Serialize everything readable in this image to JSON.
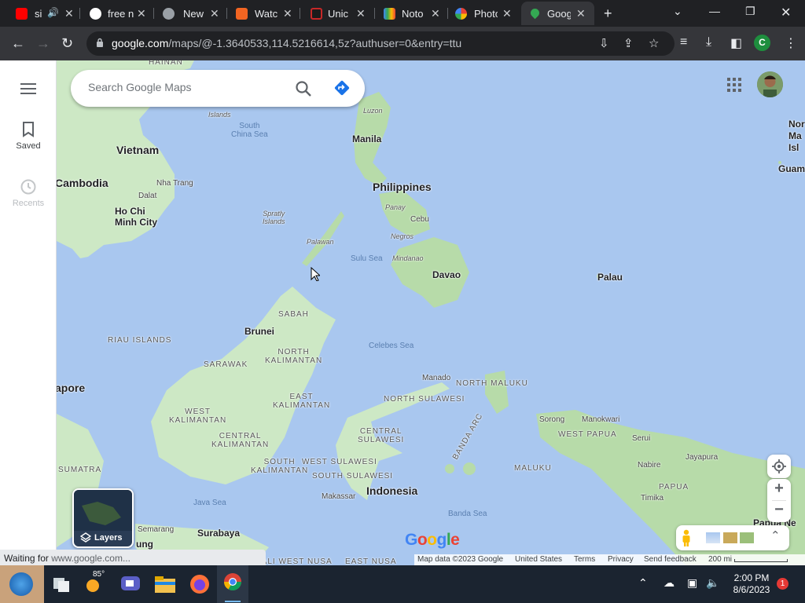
{
  "browser": {
    "tabs": [
      {
        "label": "si",
        "favicon": "youtube-icon",
        "color": "#ff0000"
      },
      {
        "label": "free n",
        "favicon": "google-icon",
        "color": "#4285f4"
      },
      {
        "label": "New",
        "favicon": "chrome-icon",
        "color": "#9aa0a6"
      },
      {
        "label": "Watc",
        "favicon": "tumblr-icon",
        "color": "#f26522"
      },
      {
        "label": "Unic",
        "favicon": "unicode-icon",
        "color": "#c62828"
      },
      {
        "label": "Noto",
        "favicon": "noto-icon",
        "color": "#34a853"
      },
      {
        "label": "Photo",
        "favicon": "photos-icon",
        "color": "#fbbc05"
      },
      {
        "label": "Goog",
        "favicon": "maps-icon",
        "color": "#34a853"
      }
    ],
    "url_domain": "google.com",
    "url_path": "/maps/@-1.3640533,114.5216614,5z?authuser=0&entry=ttu",
    "profile_initial": "C"
  },
  "sidebar": {
    "menu_icon": "hamburger-menu-icon",
    "items": [
      {
        "label": "Saved",
        "icon": "bookmark-icon"
      },
      {
        "label": "Recents",
        "icon": "history-icon"
      }
    ]
  },
  "search": {
    "placeholder": "Search Google Maps"
  },
  "map": {
    "labels": {
      "hainan": "HAINAN",
      "luzon": "Luzon",
      "islands": "Islands",
      "south_china_sea": "South\nChina Sea",
      "manila": "Manila",
      "vietnam": "Vietnam",
      "philippines": "Philippines",
      "cambodia": "Cambodia",
      "dalat": "Dalat",
      "nha_trang": "Nha Trang",
      "panay": "Panay",
      "cebu": "Cebu",
      "ho_chi_minh": "Ho Chi\nMinh City",
      "spratly": "Spratly\nIslands",
      "negros": "Negros",
      "palawan": "Palawan",
      "sulu_sea": "Sulu Sea",
      "mindanao": "Mindanao",
      "davao": "Davao",
      "palau": "Palau",
      "sabah": "SABAH",
      "brunei": "Brunei",
      "riau": "RIAU ISLANDS",
      "north_kalimantan": "NORTH\nKALIMANTAN",
      "sarawak": "SARAWAK",
      "celebes_sea": "Celebes Sea",
      "singapore": "apore",
      "manado": "Manado",
      "north_maluku": "NORTH MALUKU",
      "east_kalimantan": "EAST\nKALIMANTAN",
      "north_sulawesi": "NORTH SULAWESI",
      "west_kalimantan": "WEST\nKALIMANTAN",
      "sorong": "Sorong",
      "manokwari": "Manokwari",
      "central_sulawesi": "CENTRAL\nSULAWESI",
      "west_papua": "WEST PAPUA",
      "central_kalimantan": "CENTRAL\nKALIMANTAN",
      "serui": "Serui",
      "banda_arc": "BANDA ARC",
      "jayapura": "Jayapura",
      "south_kalimantan": "SOUTH\nKALIMANTAN",
      "west_sulawesi": "WEST SULAWESI",
      "nabire": "Nabire",
      "maluku": "MALUKU",
      "sumatra": "SUMATRA",
      "south_sulawesi": "SOUTH SULAWESI",
      "papua": "PAPUA",
      "indonesia": "Indonesia",
      "java_sea": "Java Sea",
      "makassar": "Makassar",
      "timika": "Timika",
      "banda_sea": "Banda Sea",
      "papua_new": "Papua Ne",
      "semarang": "Semarang",
      "surabaya": "Surabaya",
      "jung": "ung",
      "bali_west_nusa": "BALI WEST NUSA",
      "east_nusa": "EAST NUSA",
      "nor_ma_isl": "Nor\nMa\nIsl",
      "guam": "Guam"
    }
  },
  "controls": {
    "layers_label": "Layers",
    "zoom_in": "+",
    "zoom_out": "−"
  },
  "attribution": {
    "map_data": "Map data ©2023 Google",
    "country": "United States",
    "terms": "Terms",
    "privacy": "Privacy",
    "feedback": "Send feedback",
    "scale": "200 mi"
  },
  "google_logo": "Google",
  "status": {
    "text": "Waiting for",
    "url": "www.google.com..."
  },
  "taskbar": {
    "weather_temp": "85°",
    "time": "2:00 PM",
    "date": "8/6/2023",
    "notifications": "1"
  }
}
